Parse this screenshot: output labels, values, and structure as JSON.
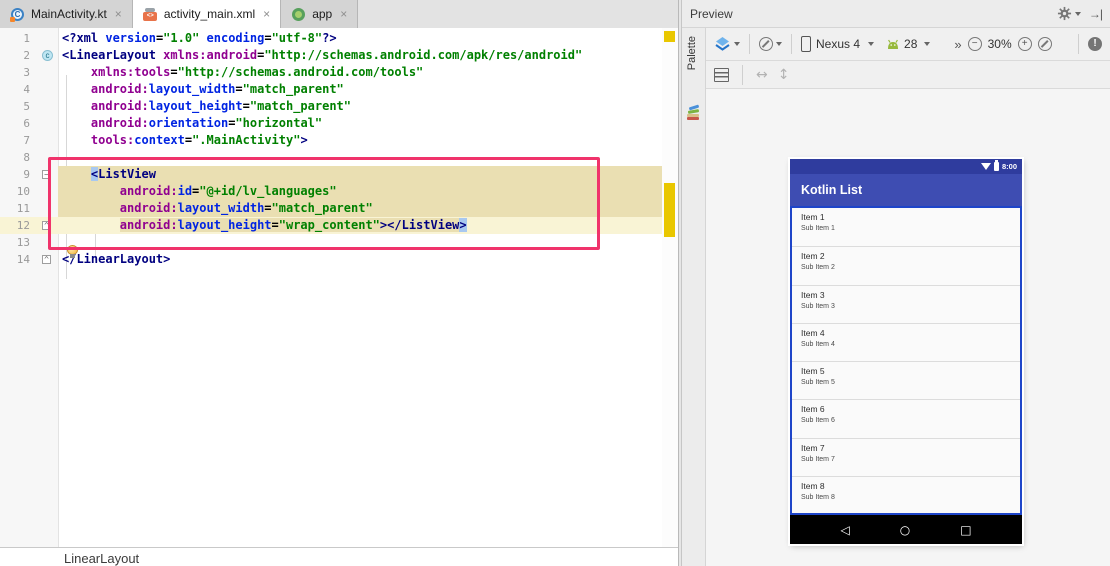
{
  "icons": {
    "close": "×",
    "caret": "▾",
    "chevrons": "»",
    "minus": "−",
    "plus": "+",
    "arrow_h": "↔",
    "arrow_v": "↕",
    "back": "◁",
    "home": "○",
    "recents": "□",
    "error": "!",
    "fold_start": "−",
    "fold_end": "^",
    "context_badge": "c",
    "xml_badge": "<>",
    "hide": "→|"
  },
  "colors": {
    "annotation": "#F0336B",
    "highlight_tan": "#EADFB2",
    "caret_line": "#F9F4D5",
    "statusbar_blue": "#2F3C9E",
    "appbar_blue": "#3E4DB2",
    "selection_border": "#1E45C9",
    "stripe_marker": "#E9C700",
    "brace_match": "#A8C8F0"
  },
  "editor": {
    "tabs": [
      {
        "label": "MainActivity.kt",
        "icon": "kotlin-file-icon",
        "active": false
      },
      {
        "label": "activity_main.xml",
        "icon": "xml-file-icon",
        "active": true
      },
      {
        "label": "app",
        "icon": "android-app-run-icon",
        "active": false
      }
    ],
    "breadcrumb": "LinearLayout",
    "code": {
      "lines": [
        {
          "n": "1",
          "segments": [
            {
              "t": "<?xml ",
              "c": "tag"
            },
            {
              "t": "version",
              "c": "attr"
            },
            {
              "t": "=",
              "c": "eq"
            },
            {
              "t": "\"1.0\"",
              "c": "val"
            },
            {
              "t": " ",
              "c": "ws"
            },
            {
              "t": "encoding",
              "c": "attr"
            },
            {
              "t": "=",
              "c": "eq"
            },
            {
              "t": "\"utf-8\"",
              "c": "val"
            },
            {
              "t": "?>",
              "c": "tag"
            }
          ]
        },
        {
          "n": "2",
          "badge": "c",
          "fold": "start",
          "segments": [
            {
              "t": "<LinearLayout ",
              "c": "tag"
            },
            {
              "t": "xmlns:android",
              "c": "ns"
            },
            {
              "t": "=",
              "c": "eq"
            },
            {
              "t": "\"http://schemas.android.com/apk/res/android\"",
              "c": "val"
            }
          ]
        },
        {
          "n": "3",
          "segments": [
            {
              "t": "    ",
              "c": "ws"
            },
            {
              "t": "xmlns:tools",
              "c": "ns"
            },
            {
              "t": "=",
              "c": "eq"
            },
            {
              "t": "\"http://schemas.android.com/tools\"",
              "c": "val"
            }
          ]
        },
        {
          "n": "4",
          "segments": [
            {
              "t": "    ",
              "c": "ws"
            },
            {
              "t": "android:",
              "c": "ns"
            },
            {
              "t": "layout_width",
              "c": "attr"
            },
            {
              "t": "=",
              "c": "eq"
            },
            {
              "t": "\"match_parent\"",
              "c": "val"
            }
          ]
        },
        {
          "n": "5",
          "segments": [
            {
              "t": "    ",
              "c": "ws"
            },
            {
              "t": "android:",
              "c": "ns"
            },
            {
              "t": "layout_height",
              "c": "attr"
            },
            {
              "t": "=",
              "c": "eq"
            },
            {
              "t": "\"match_parent\"",
              "c": "val"
            }
          ]
        },
        {
          "n": "6",
          "segments": [
            {
              "t": "    ",
              "c": "ws"
            },
            {
              "t": "android:",
              "c": "ns"
            },
            {
              "t": "orientation",
              "c": "attr"
            },
            {
              "t": "=",
              "c": "eq"
            },
            {
              "t": "\"horizontal\"",
              "c": "val"
            }
          ]
        },
        {
          "n": "7",
          "segments": [
            {
              "t": "    ",
              "c": "ws"
            },
            {
              "t": "tools:",
              "c": "ns"
            },
            {
              "t": "context",
              "c": "attr"
            },
            {
              "t": "=",
              "c": "eq"
            },
            {
              "t": "\".MainActivity\"",
              "c": "val"
            },
            {
              "t": ">",
              "c": "tag"
            }
          ]
        },
        {
          "n": "8",
          "segments": []
        },
        {
          "n": "9",
          "hl": "tan",
          "fold": "start",
          "segments": [
            {
              "t": "    ",
              "c": "ws"
            },
            {
              "t": "<",
              "c": "hlb"
            },
            {
              "t": "ListView",
              "c": "tag"
            }
          ]
        },
        {
          "n": "10",
          "hl": "tan",
          "segments": [
            {
              "t": "        ",
              "c": "ws"
            },
            {
              "t": "android:",
              "c": "ns"
            },
            {
              "t": "id",
              "c": "attr"
            },
            {
              "t": "=",
              "c": "eq"
            },
            {
              "t": "\"@+id/lv_languages\"",
              "c": "val"
            }
          ]
        },
        {
          "n": "11",
          "hl": "tan",
          "segments": [
            {
              "t": "        ",
              "c": "ws"
            },
            {
              "t": "android:",
              "c": "ns"
            },
            {
              "t": "layout_width",
              "c": "attr"
            },
            {
              "t": "=",
              "c": "eq"
            },
            {
              "t": "\"match_parent\"",
              "c": "val"
            }
          ]
        },
        {
          "n": "12",
          "hl": "caret",
          "fold": "end",
          "segments": [
            {
              "t": "        ",
              "c": "ws"
            },
            {
              "t": "android:",
              "c": "ns"
            },
            {
              "t": "layout_height",
              "c": "attr"
            },
            {
              "t": "=",
              "c": "eq"
            },
            {
              "t": "\"wrap_content\"",
              "c": "val"
            },
            {
              "t": ">",
              "c": "tag"
            },
            {
              "t": "</ListView",
              "c": "tag"
            },
            {
              "t": ">",
              "c": "hlb"
            }
          ]
        },
        {
          "n": "13",
          "segments": []
        },
        {
          "n": "14",
          "fold": "end",
          "segments": [
            {
              "t": "</LinearLayout>",
              "c": "tag"
            }
          ]
        }
      ]
    }
  },
  "preview": {
    "title": "Preview",
    "palette_label": "Palette",
    "toolbar": {
      "device_name": "Nexus 4",
      "api_level": "28",
      "zoom_level": "30%"
    },
    "device": {
      "time": "8:00",
      "app_title": "Kotlin List",
      "items": [
        {
          "title": "Item 1",
          "subtitle": "Sub Item 1"
        },
        {
          "title": "Item 2",
          "subtitle": "Sub Item 2"
        },
        {
          "title": "Item 3",
          "subtitle": "Sub Item 3"
        },
        {
          "title": "Item 4",
          "subtitle": "Sub Item 4"
        },
        {
          "title": "Item 5",
          "subtitle": "Sub Item 5"
        },
        {
          "title": "Item 6",
          "subtitle": "Sub Item 6"
        },
        {
          "title": "Item 7",
          "subtitle": "Sub Item 7"
        },
        {
          "title": "Item 8",
          "subtitle": "Sub Item 8"
        }
      ]
    }
  }
}
